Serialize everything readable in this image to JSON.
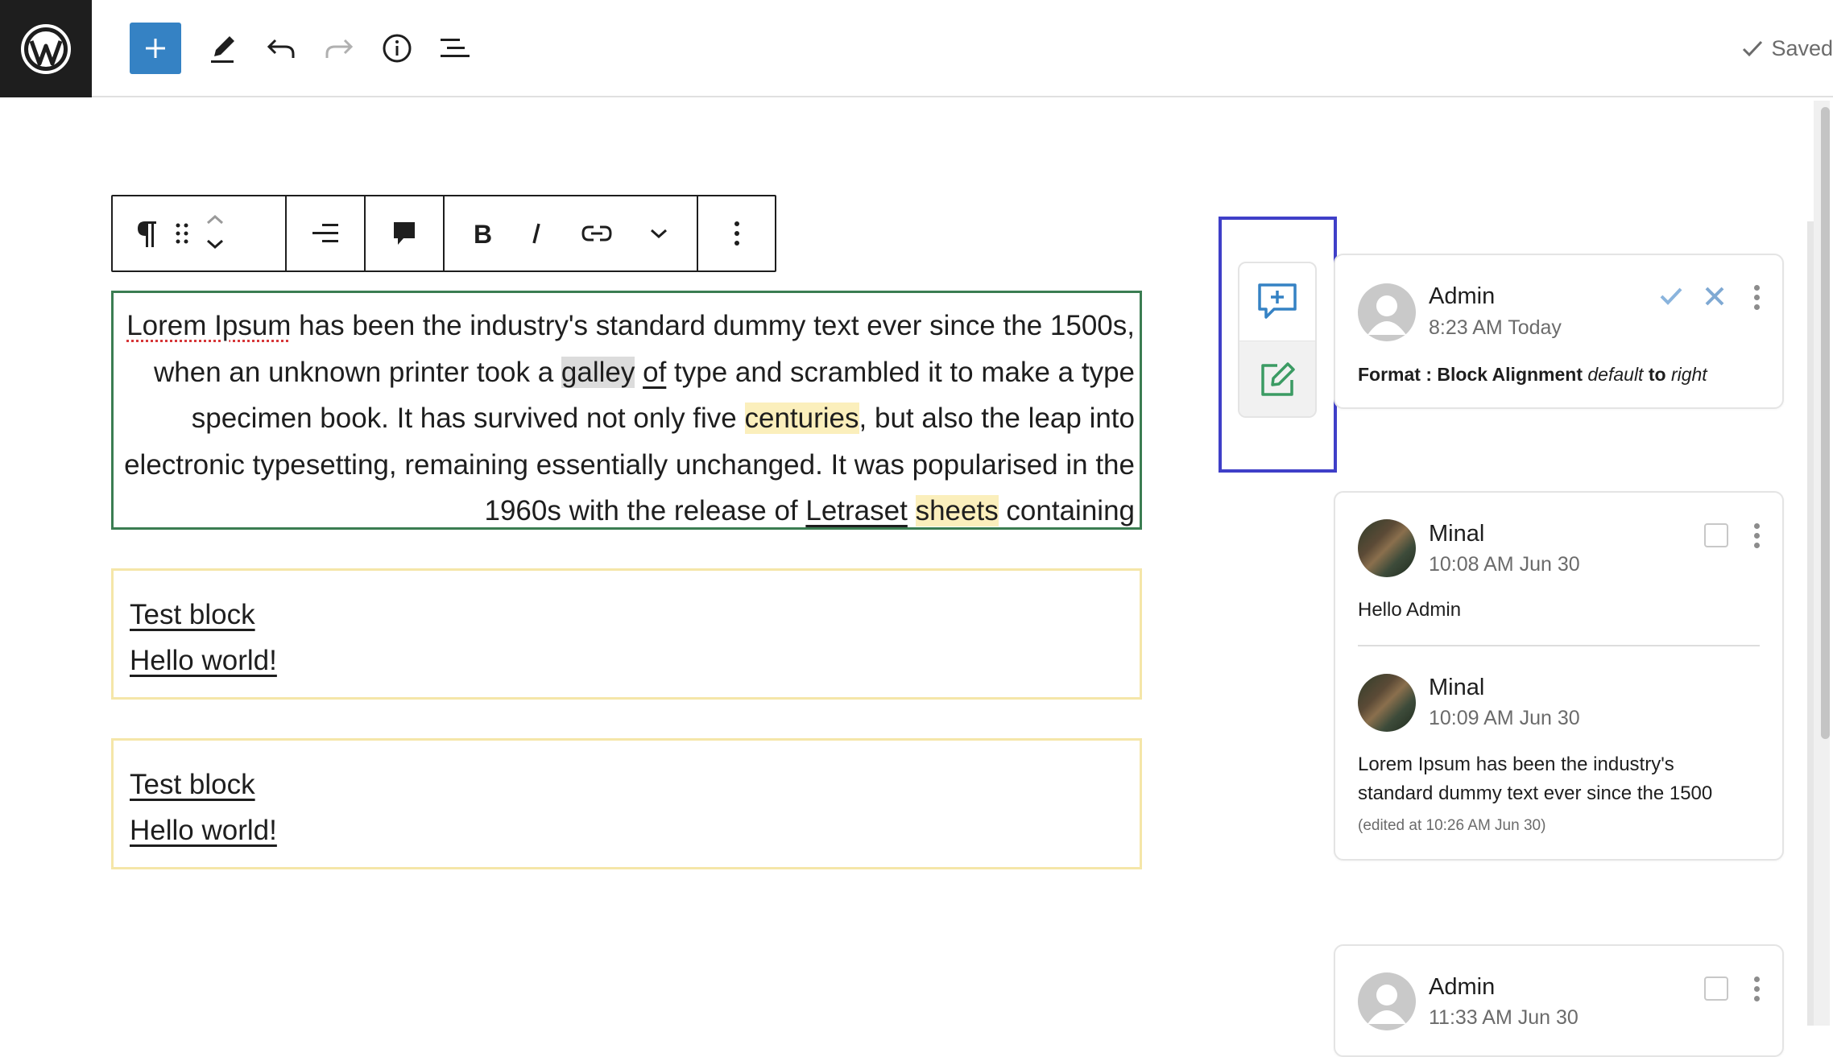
{
  "topbar": {
    "logo": "wordpress-logo",
    "buttons": [
      "add-block",
      "edit-pencil",
      "undo",
      "redo",
      "details-info",
      "list-view"
    ],
    "status_label": "Saved",
    "accent_color": "#3582c4"
  },
  "paragraph": {
    "segments": [
      {
        "text": "Lorem Ipsum",
        "style": "spell"
      },
      {
        "text": " has been the industry's standard dummy text ever since the 1500s, when an unknown printer took a ",
        "style": ""
      },
      {
        "text": "galley",
        "style": "highlight-gray"
      },
      {
        "text": " ",
        "style": ""
      },
      {
        "text": "of",
        "style": "spell-underline"
      },
      {
        "text": " type and scrambled it to make a type specimen book. It has survived not only five ",
        "style": ""
      },
      {
        "text": "centuries",
        "style": "highlight-yellow"
      },
      {
        "text": ", but also the leap into electronic typesetting, remaining essentially unchanged. It was popularised in the 1960s with the release of ",
        "style": ""
      },
      {
        "text": "Letraset",
        "style": "spell-underline"
      },
      {
        "text": " ",
        "style": ""
      },
      {
        "text": "sheets",
        "style": "highlight-yellow"
      },
      {
        "text": " containing",
        "style": ""
      }
    ],
    "border_color": "#3b7d52"
  },
  "test_blocks": [
    {
      "line1": "Test block",
      "line2": "Hello world!"
    },
    {
      "line1": "Test block",
      "line2": "Hello world!"
    }
  ],
  "actions": {
    "add_comment_icon": "add-comment-icon",
    "suggest_edit_icon": "suggest-edit-icon",
    "frame_color": "#3f3fc8"
  },
  "comments": {
    "card1": {
      "author": "Admin",
      "time": "8:23 AM Today",
      "prefix": "Format : Block Alignment",
      "from_value": "default",
      "to_word": "to",
      "to_value": "right"
    },
    "card2": {
      "c1": {
        "author": "Minal",
        "time": "10:08 AM Jun 30",
        "text": "Hello Admin"
      },
      "c2": {
        "author": "Minal",
        "time": "10:09 AM Jun 30",
        "text_line1": "Lorem Ipsum has been the industry's",
        "text_line2": "standard dummy text ever since the 1500",
        "edited": "(edited at 10:26 AM Jun 30)"
      }
    },
    "card3": {
      "author": "Admin",
      "time": "11:33 AM Jun 30"
    }
  }
}
